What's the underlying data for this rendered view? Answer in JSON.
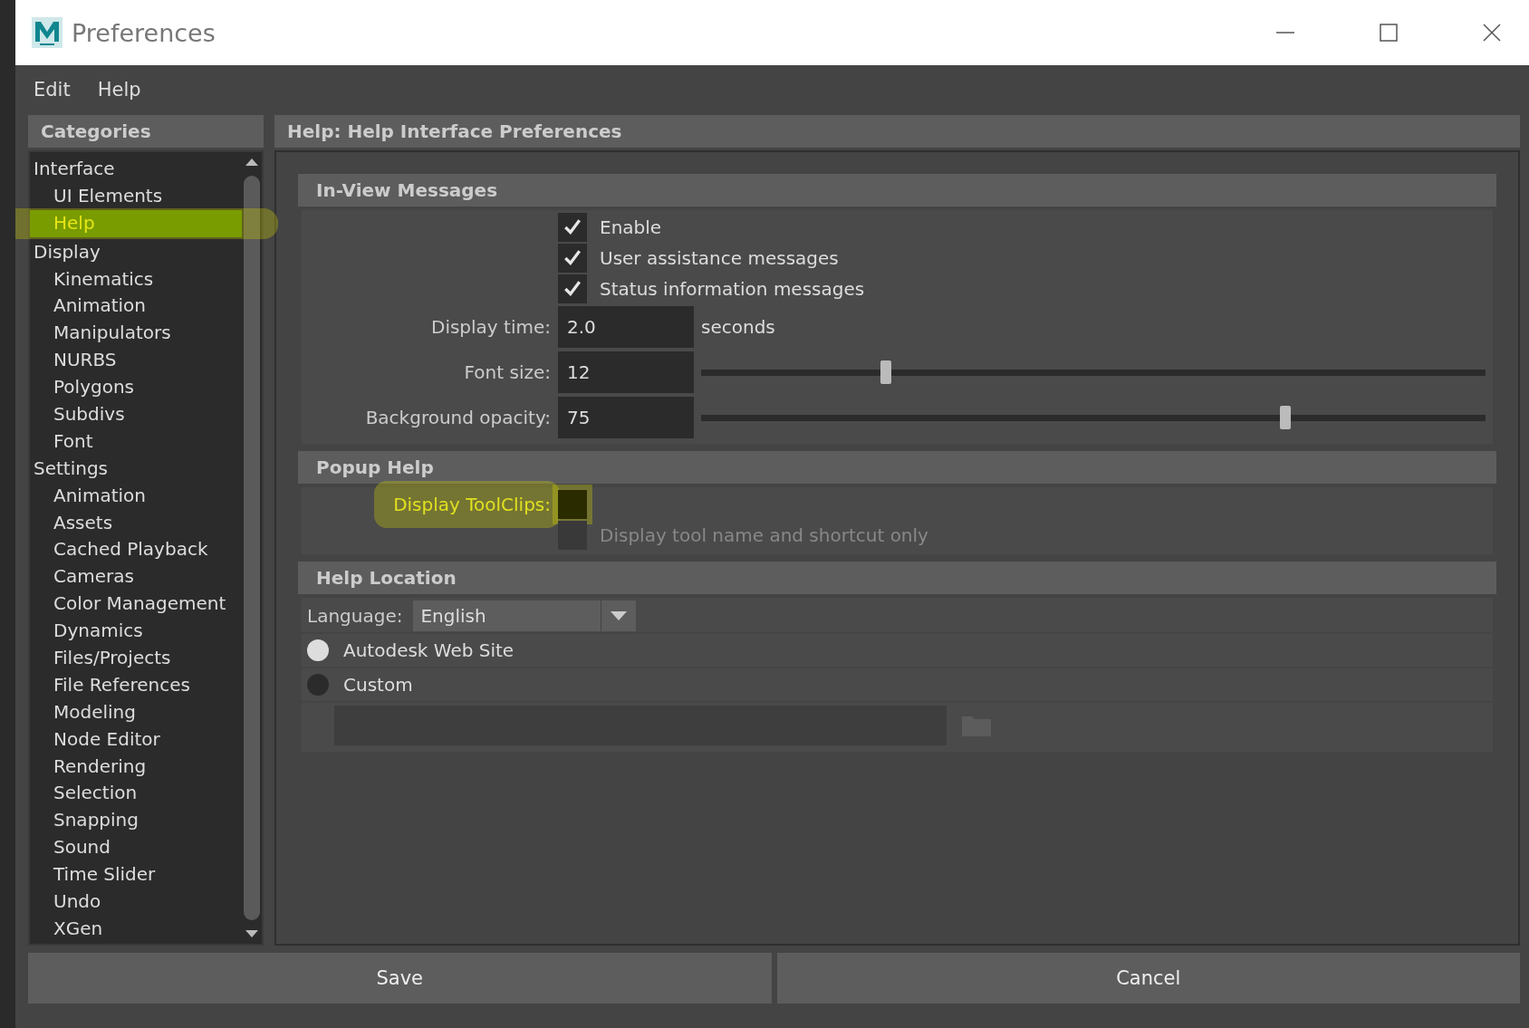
{
  "window": {
    "title": "Preferences"
  },
  "menu": [
    "Edit",
    "Help"
  ],
  "categories": {
    "title": "Categories",
    "items": [
      {
        "label": "Interface",
        "selected": false,
        "children": [
          {
            "label": "UI Elements",
            "selected": false
          },
          {
            "label": "Help",
            "selected": true,
            "highlighted": true
          }
        ]
      },
      {
        "label": "Display",
        "selected": false,
        "children": [
          {
            "label": "Kinematics",
            "selected": false
          },
          {
            "label": "Animation",
            "selected": false
          },
          {
            "label": "Manipulators",
            "selected": false
          },
          {
            "label": "NURBS",
            "selected": false
          },
          {
            "label": "Polygons",
            "selected": false
          },
          {
            "label": "Subdivs",
            "selected": false
          },
          {
            "label": "Font",
            "selected": false
          }
        ]
      },
      {
        "label": "Settings",
        "selected": false,
        "children": [
          {
            "label": "Animation",
            "selected": false
          },
          {
            "label": "Assets",
            "selected": false
          },
          {
            "label": "Cached Playback",
            "selected": false
          },
          {
            "label": "Cameras",
            "selected": false
          },
          {
            "label": "Color Management",
            "selected": false
          },
          {
            "label": "Dynamics",
            "selected": false
          },
          {
            "label": "Files/Projects",
            "selected": false
          },
          {
            "label": "File References",
            "selected": false
          },
          {
            "label": "Modeling",
            "selected": false
          },
          {
            "label": "Node Editor",
            "selected": false
          },
          {
            "label": "Rendering",
            "selected": false
          },
          {
            "label": "Selection",
            "selected": false
          },
          {
            "label": "Snapping",
            "selected": false
          },
          {
            "label": "Sound",
            "selected": false
          },
          {
            "label": "Time Slider",
            "selected": false
          },
          {
            "label": "Undo",
            "selected": false
          },
          {
            "label": "XGen",
            "selected": false
          }
        ]
      }
    ]
  },
  "panel": {
    "title": "Help: Help Interface Preferences",
    "sections": [
      {
        "title": "In-View Messages",
        "rows": [
          {
            "kind": "checkbox",
            "text": "Enable",
            "checked": true,
            "disabled": false
          },
          {
            "kind": "checkbox",
            "text": "User assistance messages",
            "checked": true,
            "disabled": false
          },
          {
            "kind": "checkbox",
            "text": "Status information messages",
            "checked": true,
            "disabled": false
          },
          {
            "kind": "field",
            "label": "Display time:",
            "value": "2.0",
            "unit": "seconds"
          },
          {
            "kind": "slider",
            "label": "Font size:",
            "value": "12",
            "level": 0.235
          },
          {
            "kind": "slider",
            "label": "Background opacity:",
            "value": "75",
            "level": 0.745
          }
        ]
      },
      {
        "title": "Popup Help",
        "rows": [
          {
            "kind": "labeled_checkbox",
            "label": "Display ToolClips:",
            "checked": false,
            "highlighted": true
          },
          {
            "kind": "checkbox",
            "text": "Display tool name and shortcut only",
            "checked": false,
            "disabled": true
          }
        ]
      },
      {
        "title": "Help Location",
        "rows": [
          {
            "kind": "dropdown",
            "label": "Language:",
            "value": "English"
          },
          {
            "kind": "radio",
            "text": "Autodesk Web Site",
            "selected": true
          },
          {
            "kind": "radio",
            "text": "Custom",
            "selected": false
          },
          {
            "kind": "path"
          }
        ]
      }
    ]
  },
  "buttons": [
    "Save",
    "Cancel"
  ]
}
